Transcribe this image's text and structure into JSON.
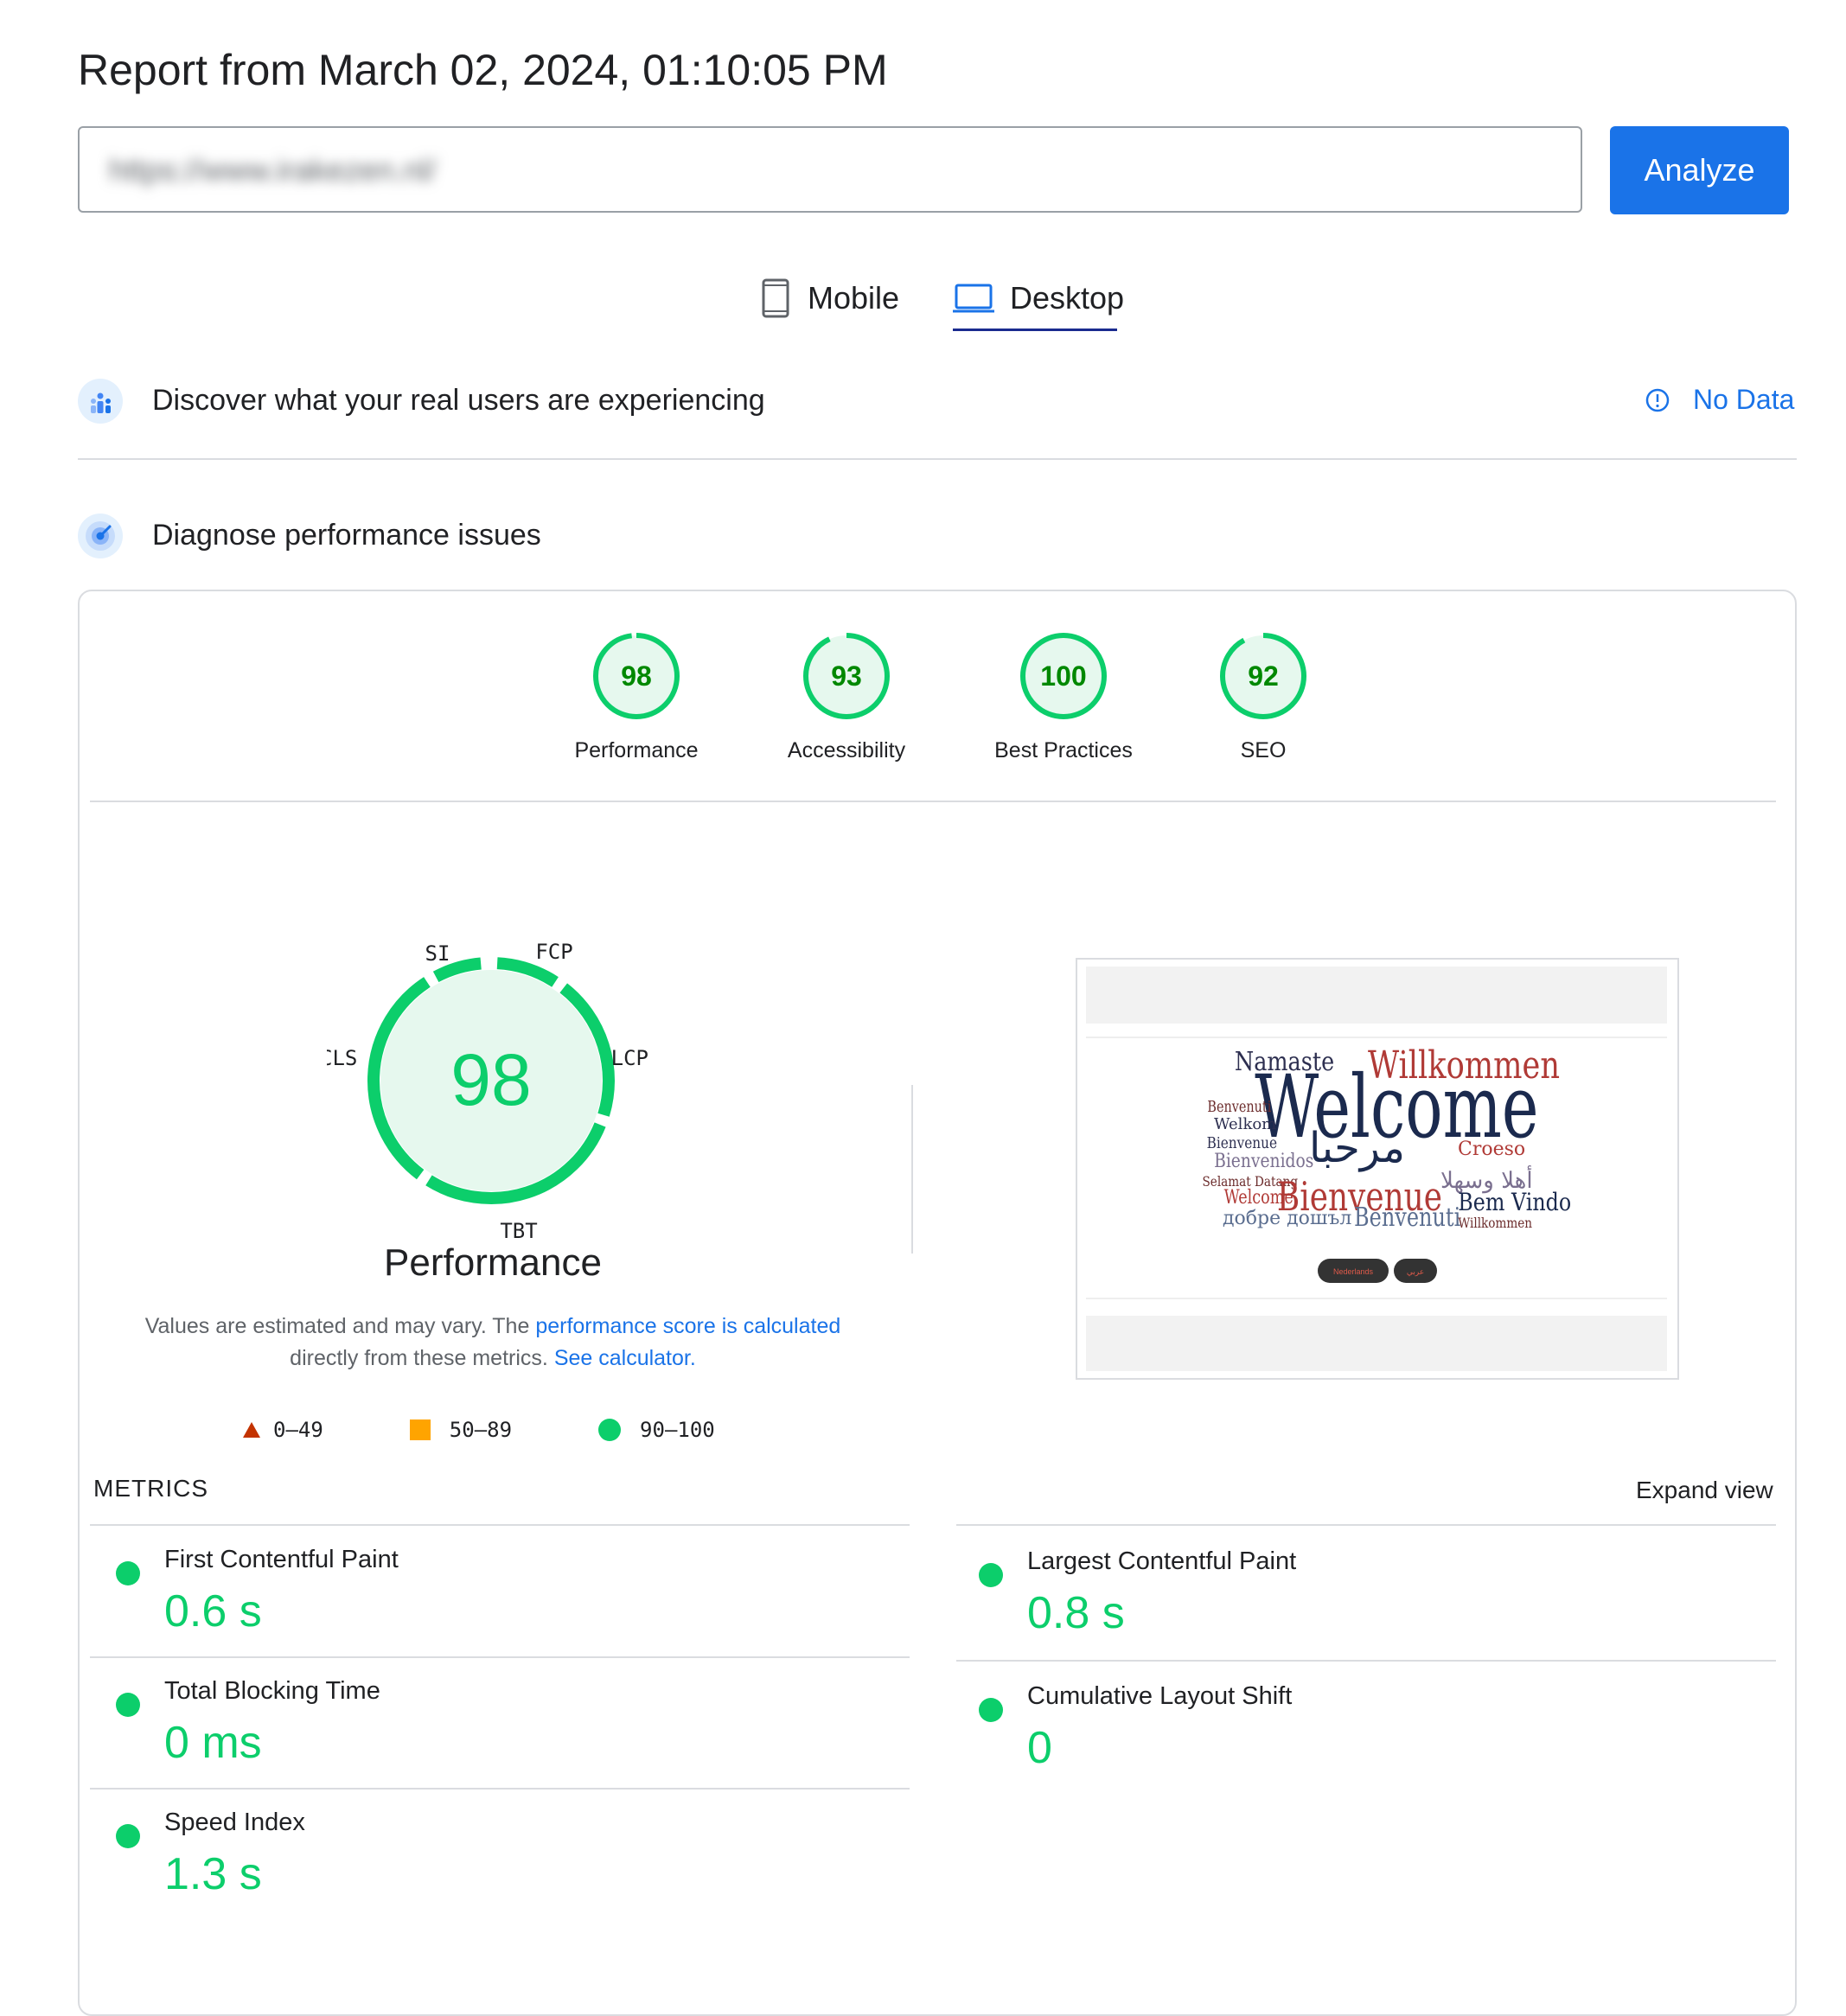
{
  "header": {
    "title": "Report from March 02, 2024, 01:10:05 PM",
    "url_value": "https://www.irakezen.nl/",
    "analyze_label": "Analyze"
  },
  "tabs": [
    {
      "label": "Mobile",
      "icon": "phone-icon",
      "selected": false
    },
    {
      "label": "Desktop",
      "icon": "laptop-icon",
      "selected": true
    }
  ],
  "crux": {
    "label": "Discover what your real users are experiencing",
    "status": "No Data",
    "icon": "chart-people-icon"
  },
  "diagnose": {
    "label": "Diagnose performance issues",
    "icon": "lighthouse-icon"
  },
  "scores": [
    {
      "value": 98,
      "label": "Performance"
    },
    {
      "value": 93,
      "label": "Accessibility"
    },
    {
      "value": 100,
      "label": "Best Practices"
    },
    {
      "value": 92,
      "label": "SEO"
    }
  ],
  "performance": {
    "score": 98,
    "title": "Performance",
    "segments": {
      "si": "SI",
      "fcp": "FCP",
      "lcp": "LCP",
      "tbt": "TBT",
      "cls": "CLS"
    },
    "disclaimer_prefix": "Values are estimated and may vary. The ",
    "disclaimer_link1": "performance score is calculated",
    "disclaimer_middle": "directly from these metrics. ",
    "disclaimer_link2": "See calculator."
  },
  "legend": [
    {
      "range": "0–49",
      "shape": "triangle",
      "color": "#c33300"
    },
    {
      "range": "50–89",
      "shape": "square",
      "color": "#ffa400"
    },
    {
      "range": "90–100",
      "shape": "circle",
      "color": "#0cce6b"
    }
  ],
  "metrics": {
    "label": "METRICS",
    "expand": "Expand view",
    "left": [
      {
        "name": "First Contentful Paint",
        "value": "0.6 s"
      },
      {
        "name": "Total Blocking Time",
        "value": "0 ms"
      },
      {
        "name": "Speed Index",
        "value": "1.3 s"
      }
    ],
    "right": [
      {
        "name": "Largest Contentful Paint",
        "value": "0.8 s"
      },
      {
        "name": "Cumulative Layout Shift",
        "value": "0"
      }
    ]
  },
  "screenshot": {
    "words": {
      "welcome": "Welcome",
      "willkommen": "Willkommen",
      "namaste": "Namaste",
      "bienvenue": "Bienvenue",
      "bemvindo": "Bem Vindo",
      "benvenuti": "Benvenuti",
      "dobre": "добре дошъл",
      "marhaba": "مرحبا",
      "ahlan": "أهلا وسهلا",
      "croeso": "Croeso",
      "bienvenidos": "Bienvenidos",
      "selamat": "Selamat Datang",
      "welkom": "Welkom"
    },
    "buttons": [
      "Nederlands",
      "عربي"
    ]
  },
  "colors": {
    "accent": "#1a73e8",
    "pass": "#0cce6b",
    "pass_dark": "#008800",
    "pass_bg": "#e6f8ee"
  }
}
